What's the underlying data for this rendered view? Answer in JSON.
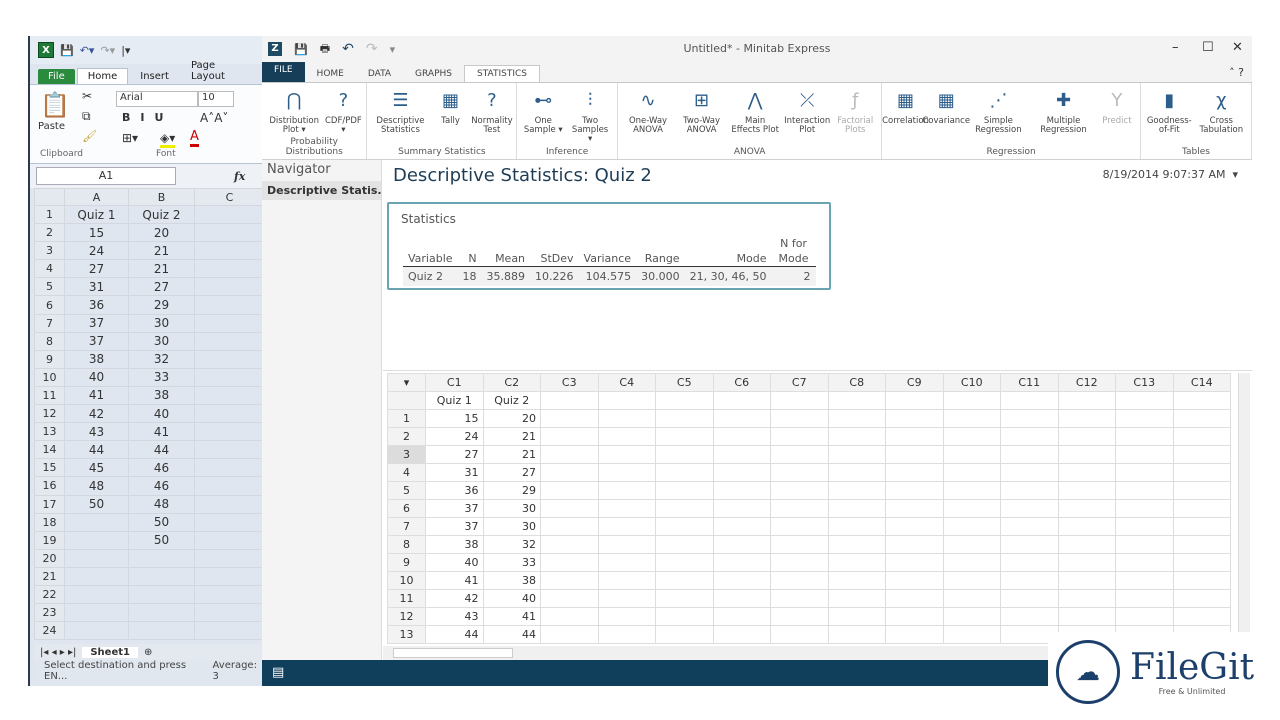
{
  "excel": {
    "tabs": [
      "File",
      "Home",
      "Insert",
      "Page Layout"
    ],
    "font_name": "Arial",
    "font_size": "10",
    "groups": [
      "Clipboard",
      "Font"
    ],
    "paste": "Paste",
    "name_box": "A1",
    "fx": "fx",
    "columns": [
      "A",
      "B",
      "C"
    ],
    "rows": [
      [
        "Quiz 1",
        "Quiz 2"
      ],
      [
        "15",
        "20"
      ],
      [
        "24",
        "21"
      ],
      [
        "27",
        "21"
      ],
      [
        "31",
        "27"
      ],
      [
        "36",
        "29"
      ],
      [
        "37",
        "30"
      ],
      [
        "37",
        "30"
      ],
      [
        "38",
        "32"
      ],
      [
        "40",
        "33"
      ],
      [
        "41",
        "38"
      ],
      [
        "42",
        "40"
      ],
      [
        "43",
        "41"
      ],
      [
        "44",
        "44"
      ],
      [
        "45",
        "46"
      ],
      [
        "48",
        "46"
      ],
      [
        "50",
        "48"
      ],
      [
        "",
        "50"
      ],
      [
        "",
        "50"
      ],
      [
        "",
        ""
      ],
      [
        "",
        ""
      ],
      [
        "",
        ""
      ],
      [
        "",
        ""
      ],
      [
        "",
        ""
      ]
    ],
    "sheet_tab": "Sheet1",
    "status_msg": "Select destination and press EN...",
    "status_avg": "Average: 3"
  },
  "minitab": {
    "title": "Untitled* - Minitab Express",
    "tabs": [
      "FILE",
      "HOME",
      "DATA",
      "GRAPHS",
      "STATISTICS"
    ],
    "active_tab": "STATISTICS",
    "ribbon": [
      {
        "group": "Probability Distributions",
        "buttons": [
          {
            "label": "Distribution Plot ▾",
            "icon": "bell-curve-icon"
          },
          {
            "label": "CDF/PDF ▾",
            "icon": "bell-curve-question-icon"
          }
        ]
      },
      {
        "group": "Summary Statistics",
        "buttons": [
          {
            "label": "Descriptive Statistics",
            "icon": "descriptive-stats-icon"
          },
          {
            "label": "Tally",
            "icon": "tally-icon"
          },
          {
            "label": "Normality Test",
            "icon": "normality-icon"
          }
        ]
      },
      {
        "group": "Inference",
        "buttons": [
          {
            "label": "One Sample ▾",
            "icon": "one-sample-icon"
          },
          {
            "label": "Two Samples ▾",
            "icon": "two-samples-icon"
          }
        ]
      },
      {
        "group": "ANOVA",
        "buttons": [
          {
            "label": "One-Way ANOVA",
            "icon": "anova-icon"
          },
          {
            "label": "Two-Way ANOVA",
            "icon": "two-way-anova-icon"
          },
          {
            "label": "Main Effects Plot",
            "icon": "main-effects-icon"
          },
          {
            "label": "Interaction Plot",
            "icon": "interaction-icon"
          },
          {
            "label": "Factorial Plots",
            "icon": "factorial-icon",
            "disabled": true
          }
        ]
      },
      {
        "group": "Regression",
        "buttons": [
          {
            "label": "Correlation",
            "icon": "correlation-icon"
          },
          {
            "label": "Covariance",
            "icon": "covariance-icon"
          },
          {
            "label": "Simple Regression",
            "icon": "scatter-icon"
          },
          {
            "label": "Multiple Regression",
            "icon": "multi-regression-icon"
          },
          {
            "label": "Predict",
            "icon": "predict-icon",
            "disabled": true
          }
        ]
      },
      {
        "group": "Tables",
        "buttons": [
          {
            "label": "Goodness-of-Fit",
            "icon": "bar-chart-icon"
          },
          {
            "label": "Cross Tabulation",
            "icon": "chi-square-table-icon"
          }
        ]
      }
    ],
    "navigator": {
      "title": "Navigator",
      "items": [
        "Descriptive Statis..."
      ]
    },
    "output": {
      "heading": "Descriptive Statistics: Quiz 2",
      "timestamp": "8/19/2014 9:07:37 AM",
      "box_title": "Statistics",
      "headers": [
        "Variable",
        "N",
        "Mean",
        "StDev",
        "Variance",
        "Range",
        "Mode",
        "N for Mode"
      ],
      "row": [
        "Quiz 2",
        "18",
        "35.889",
        "10.226",
        "104.575",
        "30.000",
        "21, 30, 46, 50",
        "2"
      ]
    },
    "worksheet": {
      "columns": [
        "C1",
        "C2",
        "C3",
        "C4",
        "C5",
        "C6",
        "C7",
        "C8",
        "C9",
        "C10",
        "C11",
        "C12",
        "C13",
        "C14"
      ],
      "names": [
        "Quiz 1",
        "Quiz 2"
      ],
      "rows": [
        [
          "15",
          "20"
        ],
        [
          "24",
          "21"
        ],
        [
          "27",
          "21"
        ],
        [
          "31",
          "27"
        ],
        [
          "36",
          "29"
        ],
        [
          "37",
          "30"
        ],
        [
          "37",
          "30"
        ],
        [
          "38",
          "32"
        ],
        [
          "40",
          "33"
        ],
        [
          "41",
          "38"
        ],
        [
          "42",
          "40"
        ],
        [
          "43",
          "41"
        ],
        [
          "44",
          "44"
        ]
      ],
      "selected_row": 3,
      "selected_col": "C4"
    }
  },
  "watermark": {
    "name": "FileGit",
    "tagline": "Free & Unlimited"
  }
}
